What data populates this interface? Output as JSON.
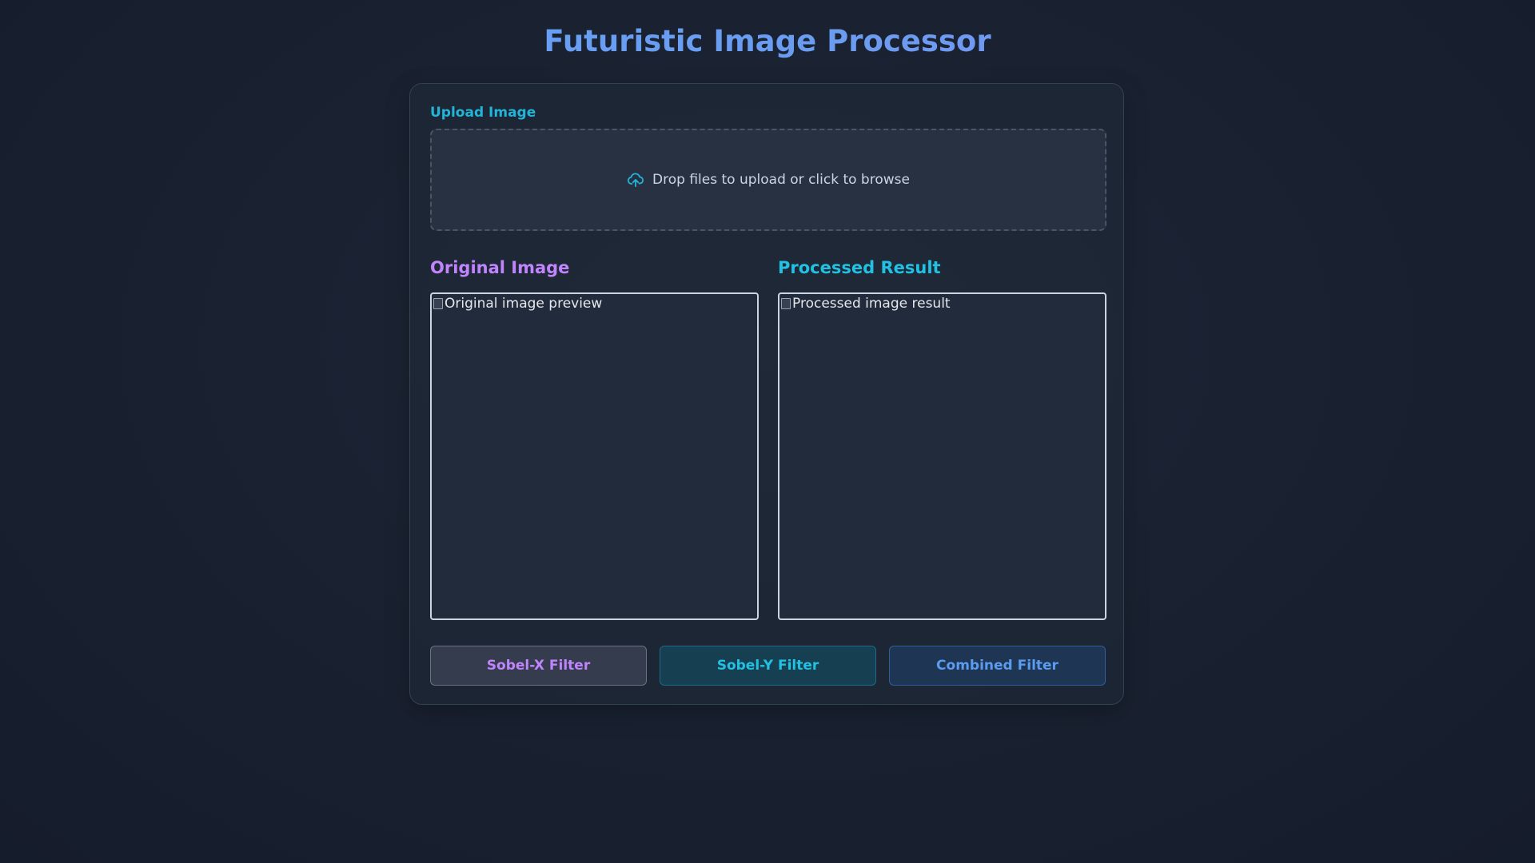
{
  "header": {
    "title": "Futuristic Image Processor"
  },
  "upload": {
    "label": "Upload Image",
    "dropzone_text": "Drop files to upload or click to browse",
    "icon": "cloud-upload-icon"
  },
  "original": {
    "title": "Original Image",
    "alt": "Original image preview"
  },
  "processed": {
    "title": "Processed Result",
    "alt": "Processed image result"
  },
  "filters": {
    "sobel_x": "Sobel-X Filter",
    "sobel_y": "Sobel-Y Filter",
    "combined": "Combined Filter"
  },
  "colors": {
    "accent_cyan": "#22c1e3",
    "accent_purple": "#c084fc",
    "accent_blue": "#5b9cf0",
    "background": "#1a2232"
  }
}
